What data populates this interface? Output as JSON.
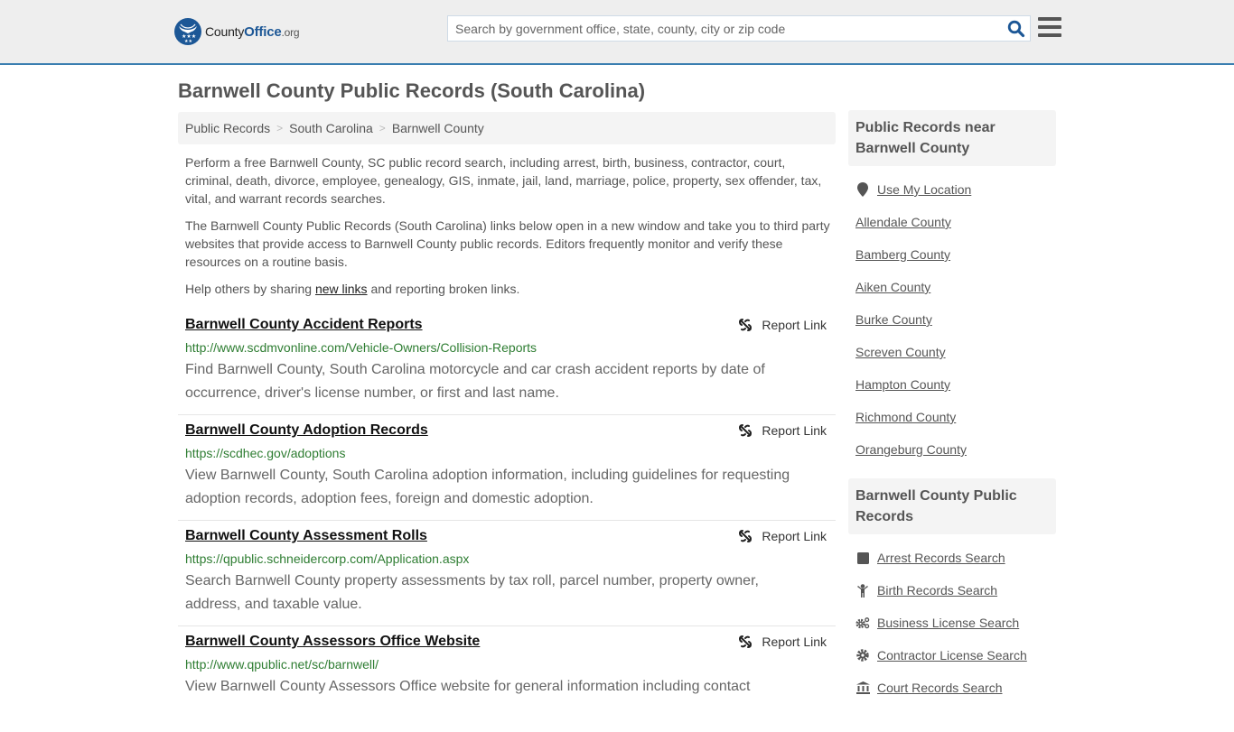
{
  "header": {
    "logo": {
      "name_part1": "County",
      "name_part2": "Office",
      "name_part3": ".org"
    },
    "search": {
      "placeholder": "Search by government office, state, county, city or zip code",
      "value": ""
    },
    "colors": {
      "brand": "#1c5796",
      "accent_border": "#3a7eb0"
    }
  },
  "page": {
    "title": "Barnwell County Public Records (South Carolina)"
  },
  "breadcrumb": [
    {
      "label": "Public Records"
    },
    {
      "label": "South Carolina"
    },
    {
      "label": "Barnwell County"
    }
  ],
  "intro": {
    "p1": "Perform a free Barnwell County, SC public record search, including arrest, birth, business, contractor, court, criminal, death, divorce, employee, genealogy, GIS, inmate, jail, land, marriage, police, property, sex offender, tax, vital, and warrant records searches.",
    "p2": "The Barnwell County Public Records (South Carolina) links below open in a new window and take you to third party websites that provide access to Barnwell County public records. Editors frequently monitor and verify these resources on a routine basis.",
    "p3_before": "Help others by sharing ",
    "p3_link": "new links",
    "p3_after": " and reporting broken links."
  },
  "records": [
    {
      "title": "Barnwell County Accident Reports",
      "url": "http://www.scdmvonline.com/Vehicle-Owners/Collision-Reports",
      "description": "Find Barnwell County, South Carolina motorcycle and car crash accident reports by date of occurrence, driver's license number, or first and last name.",
      "report_label": "Report Link"
    },
    {
      "title": "Barnwell County Adoption Records",
      "url": "https://scdhec.gov/adoptions",
      "description": "View Barnwell County, South Carolina adoption information, including guidelines for requesting adoption records, adoption fees, foreign and domestic adoption.",
      "report_label": "Report Link"
    },
    {
      "title": "Barnwell County Assessment Rolls",
      "url": "https://qpublic.schneidercorp.com/Application.aspx",
      "description": "Search Barnwell County property assessments by tax roll, parcel number, property owner, address, and taxable value.",
      "report_label": "Report Link"
    },
    {
      "title": "Barnwell County Assessors Office Website",
      "url": "http://www.qpublic.net/sc/barnwell/",
      "description": "View Barnwell County Assessors Office website for general information including contact",
      "report_label": "Report Link"
    }
  ],
  "sidebar": {
    "nearby": {
      "heading": "Public Records near Barnwell County",
      "use_location": {
        "label": "Use My Location",
        "icon": "map-marker-icon"
      },
      "counties": [
        "Allendale County",
        "Bamberg County",
        "Aiken County",
        "Burke County",
        "Screven County",
        "Hampton County",
        "Richmond County",
        "Orangeburg County"
      ]
    },
    "county_records": {
      "heading": "Barnwell County Public Records",
      "items": [
        {
          "label": "Arrest Records Search",
          "icon": "square-icon"
        },
        {
          "label": "Birth Records Search",
          "icon": "child-icon"
        },
        {
          "label": "Business License Search",
          "icon": "cogs-icon"
        },
        {
          "label": "Contractor License Search",
          "icon": "gear-icon"
        },
        {
          "label": "Court Records Search",
          "icon": "courthouse-icon"
        }
      ]
    }
  }
}
